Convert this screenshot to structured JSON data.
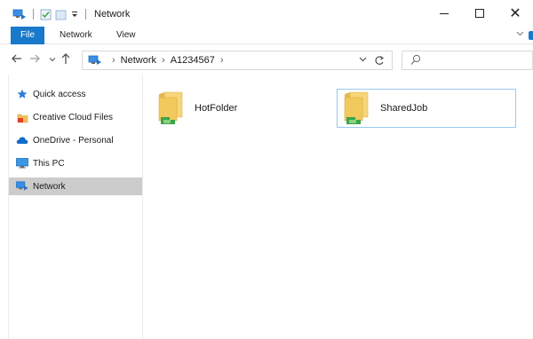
{
  "window": {
    "title": "Network",
    "controls": {
      "close_glyph": "✕"
    }
  },
  "ribbon": {
    "tabs": [
      {
        "label": "File"
      },
      {
        "label": "Network"
      },
      {
        "label": "View"
      }
    ],
    "accent_color": "#1979ca"
  },
  "address_bar": {
    "crumbs": [
      {
        "label": "Network"
      },
      {
        "label": "A1234567"
      }
    ],
    "separator": "›"
  },
  "navigation_pane": {
    "items": [
      {
        "label": "Quick access",
        "icon": "star-icon",
        "selected": false
      },
      {
        "label": "Creative Cloud Files",
        "icon": "creative-cloud-folder-icon",
        "selected": false
      },
      {
        "label": "OneDrive - Personal",
        "icon": "onedrive-cloud-icon",
        "selected": false
      },
      {
        "label": "This PC",
        "icon": "monitor-icon",
        "selected": false
      },
      {
        "label": "Network",
        "icon": "network-icon",
        "selected": true
      }
    ],
    "selected_color": "#cccccc"
  },
  "content": {
    "items": [
      {
        "label": "HotFolder",
        "icon": "shared-folder-icon",
        "selected": false
      },
      {
        "label": "SharedJob",
        "icon": "shared-folder-icon",
        "selected": true
      }
    ],
    "selection_border_color": "#99c9ef"
  }
}
